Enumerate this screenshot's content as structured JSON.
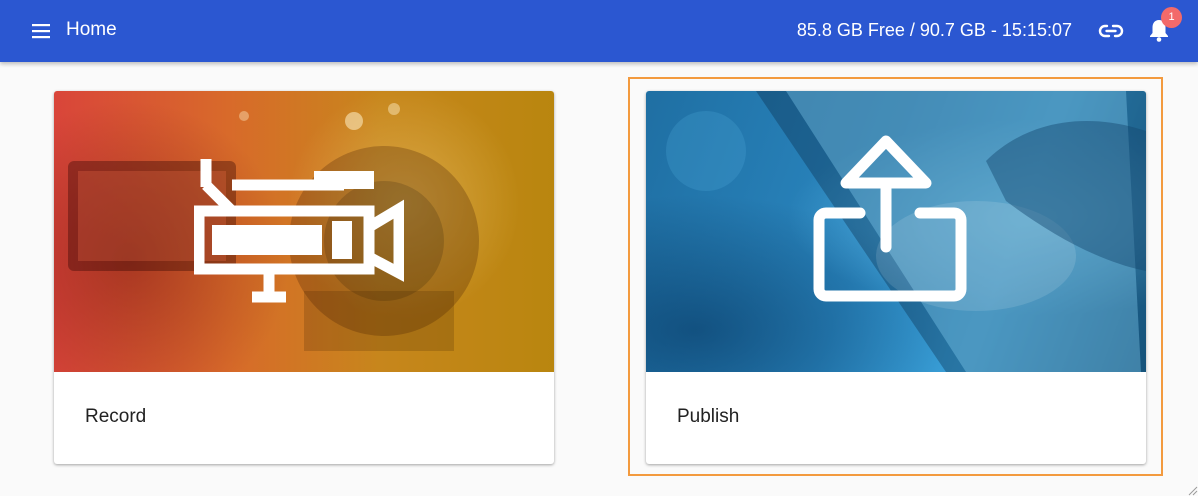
{
  "app_bar": {
    "title": "Home",
    "storage_info": "85.8 GB Free / 90.7 GB - 15:15:07",
    "notifications_count": "1",
    "icons": {
      "menu": "menu-icon",
      "link": "link-icon",
      "notifications": "bell-icon"
    },
    "color": "#2b57d1"
  },
  "cards": [
    {
      "label": "Record",
      "icon": "video-camera-icon"
    },
    {
      "label": "Publish",
      "icon": "upload-icon"
    }
  ],
  "colors": {
    "focus_outline": "#f39a3e",
    "badge": "#f26a6a",
    "background": "#fafafa"
  }
}
